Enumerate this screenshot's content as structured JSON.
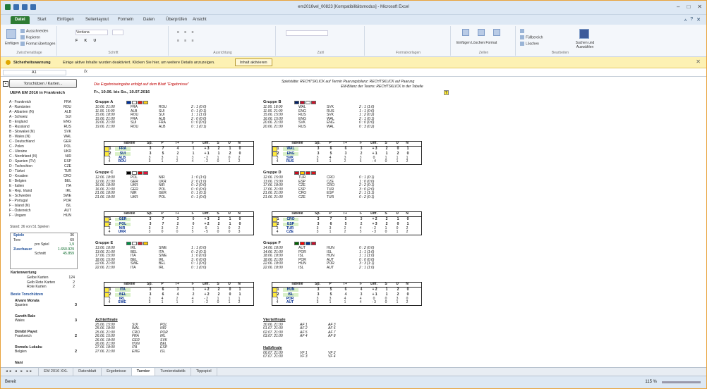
{
  "window": {
    "title": "em2016vel_00823 [Kompatibilitätsmodus] - Microsoft Excel"
  },
  "tabs": [
    "Datei",
    "Start",
    "Einfügen",
    "Seitenlayout",
    "Formeln",
    "Daten",
    "Überprüfen",
    "Ansicht"
  ],
  "ribbon": {
    "groups": [
      "Zwischenablage",
      "Schrift",
      "Ausrichtung",
      "Zahl",
      "Formatvorlagen",
      "Zellen",
      "Bearbeiten"
    ],
    "paste": "Einfügen",
    "cut": "Ausschneiden",
    "copy": "Kopieren",
    "format_painter": "Format übertragen",
    "font": "Verdana",
    "cells": "Einfügen Löschen Format",
    "fill": "Füllbereich",
    "clear": "Löschen",
    "find": "Suchen und Auswählen"
  },
  "security": {
    "label": "Sicherheitswarnung",
    "message": "Einige aktive Inhalte wurden deaktiviert. Klicken Sie hier, um weitere Details anzuzeigen.",
    "button": "Inhalt aktivieren"
  },
  "formula": {
    "cell": "A1",
    "fx": "fx"
  },
  "sheet": {
    "button": "Torschützen / Karten...",
    "title": "UEFA EM 2016 in Frankreich",
    "notice": "Die Ergebniseingabe erfolgt auf dem Blatt \"Ergebnisse\"",
    "dates": "Fr., 10.06. bis So., 10.07.2016",
    "legend1": "Spielstätte: RECHTSKLICK auf Termin    Paarungsbilanz: RECHTSKLICK auf Paarung",
    "legend2": "EM-Bilanz der Teams: RECHTSKLICK in der Tabelle",
    "help": "?",
    "teams": [
      [
        "A - Frankreich",
        "FRA"
      ],
      [
        "A - Rumänien",
        "ROU"
      ],
      [
        "A - Albanien (N)",
        "ALB"
      ],
      [
        "A - Schweiz",
        "SUI"
      ],
      [
        "B - England",
        "ENG"
      ],
      [
        "B - Russland",
        "RUS"
      ],
      [
        "B - Slowakei (N)",
        "SVK"
      ],
      [
        "B - Wales (N)",
        "WAL"
      ],
      [
        "C - Deutschland",
        "GER"
      ],
      [
        "C - Polen",
        "POL"
      ],
      [
        "C - Ukraine",
        "UKR"
      ],
      [
        "C - Nordirland (N)",
        "NIR"
      ],
      [
        "D - Spanien (TV)",
        "ESP"
      ],
      [
        "D - Tschechien",
        "CZE"
      ],
      [
        "D - Türkei",
        "TUR"
      ],
      [
        "D - Kroatien",
        "CRO"
      ],
      [
        "E - Belgien",
        "BEL"
      ],
      [
        "E - Italien",
        "ITA"
      ],
      [
        "E - Rep. Irland",
        "IRL"
      ],
      [
        "E - Schweden",
        "SWE"
      ],
      [
        "F - Portugal",
        "POR"
      ],
      [
        "F - Island (N)",
        "ISL"
      ],
      [
        "F - Österreich",
        "AUT"
      ],
      [
        "F - Ungarn",
        "HUN"
      ]
    ],
    "stand": "Stand: 36 von 51 Spielen",
    "stats": [
      [
        "Spiele",
        "36"
      ],
      [
        "Tore",
        "69"
      ],
      [
        "pro Spiel",
        "1,9"
      ],
      [
        "Zuschauer",
        "1.650.929"
      ],
      [
        "Schnitt",
        "45.859"
      ]
    ],
    "cards_title": "Kartenwertung",
    "cards": [
      [
        "Gelbe Karten",
        "124"
      ],
      [
        "Gelb Rote Karten",
        "2"
      ],
      [
        "Rote Karten",
        "2"
      ]
    ],
    "scorers_title": "Beste Torschützen",
    "scorers": [
      [
        "Alvaro Morata",
        "Spanien",
        "3"
      ],
      [
        "Gareth Bale",
        "Wales",
        "3"
      ],
      [
        "Dimitri Payet",
        "Frankreich",
        "2"
      ],
      [
        "Romelu Lukaku",
        "Belgien",
        "2"
      ],
      [
        "Nani",
        "",
        ""
      ]
    ]
  },
  "table_header": [
    "Tabelle",
    "Sp.",
    "P",
    "T+",
    "T-",
    "Diff.",
    "S",
    "U",
    "N"
  ],
  "groups": [
    {
      "name": "Gruppe A",
      "matches": [
        [
          "10.06. 21:00",
          "FRA",
          "ROU",
          "2 : 1 (0:0)"
        ],
        [
          "11.06. 15:00",
          "ALB",
          "SUI",
          "0 : 1 (0:1)"
        ],
        [
          "15.06. 18:00",
          "ROU",
          "SUI",
          "1 : 1 (1:0)"
        ],
        [
          "15.06. 21:00",
          "FRA",
          "ALB",
          "2 : 0 (0:0)"
        ],
        [
          "19.06. 21:00",
          "SUI",
          "FRA",
          "0 : 0 (0:0)"
        ],
        [
          "19.06. 21:00",
          "ROU",
          "ALB",
          "0 : 1 (0:1)"
        ]
      ],
      "table": [
        [
          "1",
          "FRA",
          "3",
          "7",
          "4",
          "1",
          "+ 3",
          "2",
          "1",
          "0"
        ],
        [
          "2",
          "SUI",
          "3",
          "5",
          "2",
          "1",
          "+ 1",
          "1",
          "2",
          "0"
        ],
        [
          "3",
          "ALB",
          "3",
          "3",
          "1",
          "3",
          "- 2",
          "1",
          "0",
          "2"
        ],
        [
          "4",
          "ROU",
          "3",
          "1",
          "2",
          "4",
          "- 2",
          "0",
          "1",
          "2"
        ]
      ]
    },
    {
      "name": "Gruppe B",
      "matches": [
        [
          "11.06. 18:00",
          "WAL",
          "SVK",
          "2 : 1 (1:0)"
        ],
        [
          "11.06. 21:00",
          "ENG",
          "RUS",
          "1 : 1 (0:0)"
        ],
        [
          "15.06. 15:00",
          "RUS",
          "SVK",
          "1 : 2 (0:2)"
        ],
        [
          "16.06. 15:00",
          "ENG",
          "WAL",
          "2 : 1 (0:1)"
        ],
        [
          "20.06. 21:00",
          "SVK",
          "ENG",
          "0 : 0 (0:0)"
        ],
        [
          "20.06. 21:00",
          "RUS",
          "WAL",
          "0 : 3 (0:2)"
        ]
      ],
      "table": [
        [
          "1",
          "WAL",
          "3",
          "6",
          "6",
          "3",
          "+ 3",
          "2",
          "0",
          "1"
        ],
        [
          "2",
          "ENG",
          "3",
          "5",
          "3",
          "2",
          "+ 1",
          "1",
          "2",
          "0"
        ],
        [
          "3",
          "SVK",
          "3",
          "4",
          "3",
          "3",
          "0",
          "1",
          "1",
          "1"
        ],
        [
          "4",
          "RUS",
          "3",
          "1",
          "2",
          "6",
          "- 4",
          "0",
          "1",
          "2"
        ]
      ]
    },
    {
      "name": "Gruppe C",
      "matches": [
        [
          "12.06. 18:00",
          "POL",
          "NIR",
          "1 : 0 (1:0)"
        ],
        [
          "12.06. 21:00",
          "GER",
          "UKR",
          "2 : 0 (1:0)"
        ],
        [
          "16.06. 18:00",
          "UKR",
          "NIR",
          "0 : 2 (0:0)"
        ],
        [
          "16.06. 21:00",
          "GER",
          "POL",
          "0 : 0 (0:0)"
        ],
        [
          "21.06. 18:00",
          "NIR",
          "GER",
          "0 : 1 (0:1)"
        ],
        [
          "21.06. 18:00",
          "UKR",
          "POL",
          "0 : 1 (0:0)"
        ]
      ],
      "table": [
        [
          "1",
          "GER",
          "3",
          "7",
          "3",
          "0",
          "+ 3",
          "2",
          "1",
          "0"
        ],
        [
          "2",
          "POL",
          "3",
          "7",
          "2",
          "0",
          "+ 2",
          "2",
          "1",
          "0"
        ],
        [
          "3",
          "NIR",
          "3",
          "3",
          "2",
          "2",
          "0",
          "1",
          "0",
          "2"
        ],
        [
          "4",
          "UKR",
          "3",
          "0",
          "0",
          "5",
          "- 5",
          "0",
          "0",
          "3"
        ]
      ]
    },
    {
      "name": "Gruppe D",
      "matches": [
        [
          "12.06. 15:00",
          "TUR",
          "CRO",
          "0 : 1 (0:1)"
        ],
        [
          "13.06. 15:00",
          "ESP",
          "CZE",
          "1 : 0 (0:0)"
        ],
        [
          "17.06. 18:00",
          "CZE",
          "CRO",
          "2 : 2 (0:1)"
        ],
        [
          "17.06. 21:00",
          "ESP",
          "TUR",
          "3 : 0 (2:0)"
        ],
        [
          "21.06. 21:00",
          "CRO",
          "ESP",
          "2 : 1 (1:1)"
        ],
        [
          "21.06. 21:00",
          "CZE",
          "TUR",
          "0 : 2 (0:1)"
        ]
      ],
      "table": [
        [
          "1",
          "CRO",
          "3",
          "7",
          "5",
          "3",
          "+ 2",
          "2",
          "1",
          "0"
        ],
        [
          "2",
          "ESP",
          "3",
          "6",
          "5",
          "2",
          "+ 3",
          "2",
          "0",
          "1"
        ],
        [
          "3",
          "TUR",
          "3",
          "3",
          "2",
          "4",
          "- 2",
          "1",
          "0",
          "2"
        ],
        [
          "4",
          "CZE",
          "3",
          "1",
          "2",
          "5",
          "- 3",
          "0",
          "1",
          "2"
        ]
      ]
    },
    {
      "name": "Gruppe E",
      "matches": [
        [
          "13.06. 18:00",
          "IRL",
          "SWE",
          "1 : 1 (0:0)"
        ],
        [
          "13.06. 21:00",
          "BEL",
          "ITA",
          "0 : 2 (0:1)"
        ],
        [
          "17.06. 15:00",
          "ITA",
          "SWE",
          "1 : 0 (0:0)"
        ],
        [
          "18.06. 15:00",
          "BEL",
          "IRL",
          "3 : 0 (0:0)"
        ],
        [
          "22.06. 21:00",
          "SWE",
          "BEL",
          "0 : 1 (0:0)"
        ],
        [
          "22.06. 21:00",
          "ITA",
          "IRL",
          "0 : 1 (0:0)"
        ]
      ],
      "table": [
        [
          "1",
          "ITA",
          "3",
          "6",
          "3",
          "1",
          "+ 2",
          "2",
          "0",
          "1"
        ],
        [
          "2",
          "BEL",
          "3",
          "6",
          "4",
          "2",
          "+ 2",
          "2",
          "0",
          "1"
        ],
        [
          "3",
          "IRL",
          "3",
          "4",
          "2",
          "4",
          "- 2",
          "1",
          "1",
          "1"
        ],
        [
          "4",
          "SWE",
          "3",
          "1",
          "1",
          "3",
          "- 2",
          "0",
          "1",
          "2"
        ]
      ]
    },
    {
      "name": "Gruppe F",
      "matches": [
        [
          "14.06. 18:00",
          "AUT",
          "HUN",
          "0 : 2 (0:0)"
        ],
        [
          "14.06. 21:00",
          "POR",
          "ISL",
          "1 : 1 (1:0)"
        ],
        [
          "18.06. 18:00",
          "ISL",
          "HUN",
          "1 : 1 (1:0)"
        ],
        [
          "18.06. 21:00",
          "POR",
          "AUT",
          "0 : 0 (0:0)"
        ],
        [
          "22.06. 18:00",
          "HUN",
          "POR",
          "3 : 3 (1:1)"
        ],
        [
          "22.06. 18:00",
          "ISL",
          "AUT",
          "2 : 1 (1:0)"
        ]
      ],
      "table": [
        [
          "1",
          "HUN",
          "3",
          "5",
          "6",
          "4",
          "+ 2",
          "1",
          "2",
          "0"
        ],
        [
          "2",
          "ISL",
          "3",
          "5",
          "4",
          "3",
          "+ 1",
          "1",
          "2",
          "0"
        ],
        [
          "3",
          "POR",
          "3",
          "3",
          "4",
          "4",
          "0",
          "0",
          "3",
          "0"
        ],
        [
          "4",
          "AUT",
          "3",
          "1",
          "1",
          "4",
          "- 3",
          "0",
          "1",
          "2"
        ]
      ]
    }
  ],
  "achtelfinale": {
    "title": "Achtelfinale",
    "matches": [
      [
        "25.06. 15:00",
        "SUI",
        "POL"
      ],
      [
        "25.06. 18:00",
        "WAL",
        "NIR"
      ],
      [
        "25.06. 21:00",
        "CRO",
        "POR"
      ],
      [
        "26.06. 15:00",
        "FRA",
        "IRL"
      ],
      [
        "26.06. 18:00",
        "GER",
        "SVK"
      ],
      [
        "26.06. 21:00",
        "HUN",
        "BEL"
      ],
      [
        "27.06. 18:00",
        "ITA",
        "ESP"
      ],
      [
        "27.06. 21:00",
        "ENG",
        "ISL"
      ]
    ]
  },
  "viertelfinale": {
    "title": "Viertelfinale",
    "matches": [
      [
        "30.06. 21:00",
        "AF 1",
        "AF 3"
      ],
      [
        "01.07. 21:00",
        "AF 2",
        "AF 6"
      ],
      [
        "02.07. 21:00",
        "AF 5",
        "AF 7"
      ],
      [
        "03.07. 21:00",
        "AF 4",
        "AF 8"
      ]
    ]
  },
  "halbfinale": {
    "title": "Halbfinale",
    "matches": [
      [
        "06.07. 21:00",
        "VF 1",
        "VF 2"
      ],
      [
        "07.07. 21:00",
        "VF 3",
        "VF 4"
      ]
    ]
  },
  "sheet_tabs": [
    "EM 2016 XXL",
    "Datenblatt",
    "Ergebnisse",
    "Turnier",
    "Turnierstatistik",
    "Tippspiel"
  ],
  "status": {
    "left": "Bereit",
    "zoom": "115 %"
  }
}
